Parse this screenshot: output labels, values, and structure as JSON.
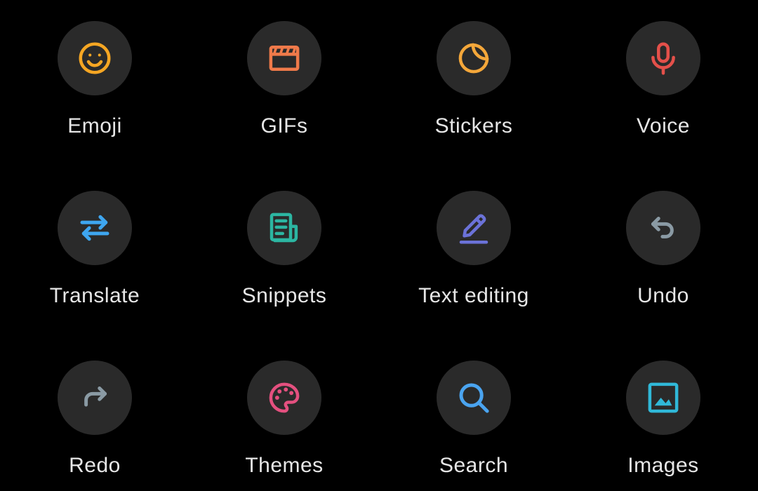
{
  "colors": {
    "background": "#000000",
    "tile_circle": "#2a2a2a",
    "label": "#e6e6e6"
  },
  "items": [
    {
      "label": "Emoji",
      "icon": "emoji-smile-icon",
      "color": "#f5a623"
    },
    {
      "label": "GIFs",
      "icon": "clapperboard-icon",
      "color": "#f07a4a"
    },
    {
      "label": "Stickers",
      "icon": "sticker-icon",
      "color": "#f4a73a"
    },
    {
      "label": "Voice",
      "icon": "microphone-icon",
      "color": "#e4504a"
    },
    {
      "label": "Translate",
      "icon": "swap-arrows-icon",
      "color": "#3ea6f0"
    },
    {
      "label": "Snippets",
      "icon": "clipboard-note-icon",
      "color": "#2cb6a2"
    },
    {
      "label": "Text editing",
      "icon": "pencil-icon",
      "color": "#6b72d8"
    },
    {
      "label": "Undo",
      "icon": "undo-icon",
      "color": "#8a9aa4"
    },
    {
      "label": "Redo",
      "icon": "redo-icon",
      "color": "#8a9aa4"
    },
    {
      "label": "Themes",
      "icon": "palette-icon",
      "color": "#e4507f"
    },
    {
      "label": "Search",
      "icon": "search-icon",
      "color": "#4aa4f0"
    },
    {
      "label": "Images",
      "icon": "image-icon",
      "color": "#30b8d8"
    }
  ]
}
